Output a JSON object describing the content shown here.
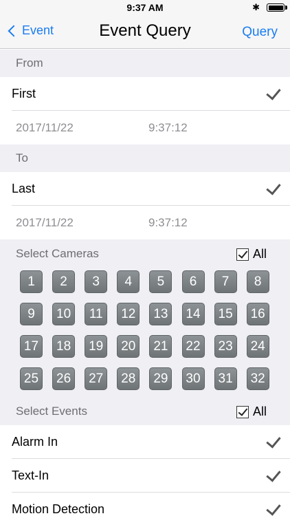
{
  "status": {
    "time": "9:37 AM"
  },
  "nav": {
    "back_label": "Event",
    "title": "Event Query",
    "action_label": "Query"
  },
  "from": {
    "header": "From",
    "option": "First",
    "date": "2017/11/22",
    "time": "9:37:12"
  },
  "to": {
    "header": "To",
    "option": "Last",
    "date": "2017/11/22",
    "time": "9:37:12"
  },
  "cameras": {
    "header": "Select Cameras",
    "all_label": "All",
    "items": [
      "1",
      "2",
      "3",
      "4",
      "5",
      "6",
      "7",
      "8",
      "9",
      "10",
      "11",
      "12",
      "13",
      "14",
      "15",
      "16",
      "17",
      "18",
      "19",
      "20",
      "21",
      "22",
      "23",
      "24",
      "25",
      "26",
      "27",
      "28",
      "29",
      "30",
      "31",
      "32"
    ]
  },
  "events": {
    "header": "Select Events",
    "all_label": "All",
    "items": [
      {
        "label": "Alarm In"
      },
      {
        "label": "Text-In"
      },
      {
        "label": "Motion Detection"
      }
    ]
  },
  "colors": {
    "accent": "#1a7cf0",
    "section_bg": "#efeff4",
    "camera_button": "#7b8184"
  }
}
